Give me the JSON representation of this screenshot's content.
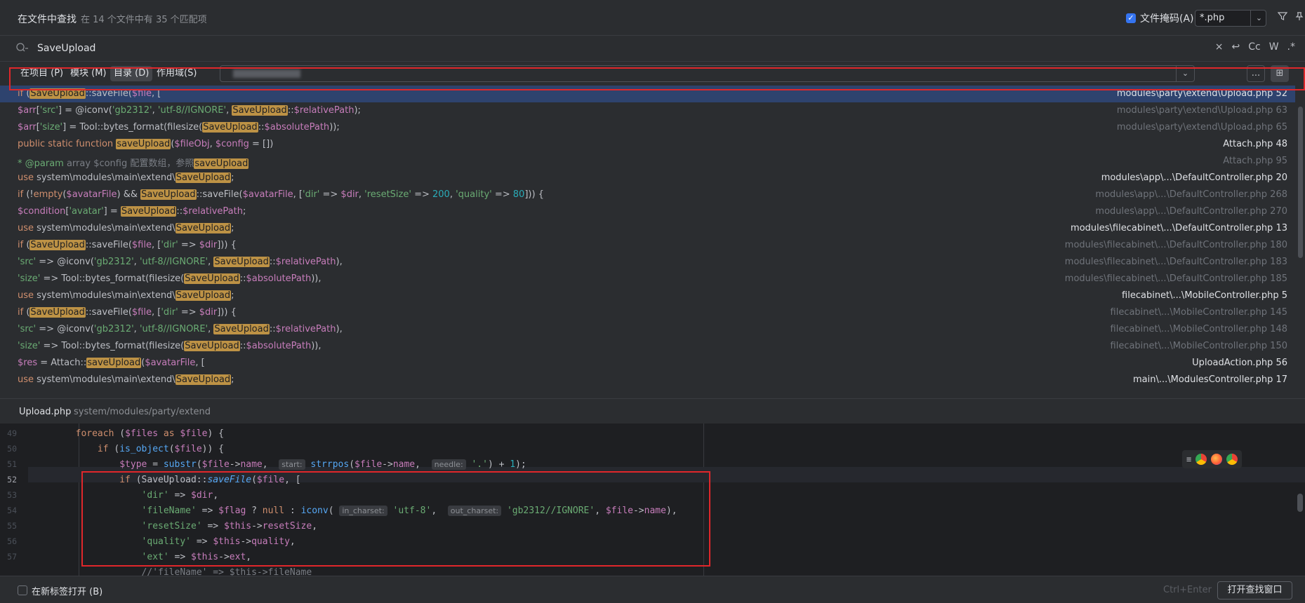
{
  "header": {
    "title": "在文件中查找",
    "subtitle": "在 14 个文件中有 35 个匹配项",
    "file_mask_label": "文件掩码(A):",
    "file_mask_checked": true,
    "file_mask_value": "*.php",
    "filter_icon": "filter-icon",
    "pin_icon": "pin-icon"
  },
  "search": {
    "query": "SaveUpload",
    "icons": [
      "search-icon",
      "clear-icon",
      "newline-icon",
      "match-case",
      "words",
      "regex"
    ],
    "match_case_label": "Cc",
    "words_label": "W",
    "regex_label": ".*"
  },
  "scope": {
    "tabs": [
      "在项目 (P)",
      "模块 (M)",
      "目录 (D)",
      "作用域(S)"
    ],
    "active_tab": "目录 (D)",
    "more_label": "..."
  },
  "results": [
    {
      "code": "if (SaveUpload::saveFile($file, [",
      "location": "modules\\party\\extend\\Upload.php 52",
      "selected": true
    },
    {
      "code": "$arr['src'] = @iconv('gb2312', 'utf-8//IGNORE', SaveUpload::$relativePath);",
      "location": "modules\\party\\extend\\Upload.php 63"
    },
    {
      "code": "$arr['size'] = Tool::bytes_format(filesize(SaveUpload::$absolutePath));",
      "location": "modules\\party\\extend\\Upload.php 65"
    },
    {
      "code": "public static function saveUpload($fileObj, $config = [])",
      "location": "Attach.php 48"
    },
    {
      "code": "* @param array $config 配置数组，参照saveUpload",
      "location": "Attach.php 95"
    },
    {
      "code": "use system\\modules\\main\\extend\\SaveUpload;",
      "location": "modules\\app\\...\\DefaultController.php 20"
    },
    {
      "code": "if (!empty($avatarFile) && SaveUpload::saveFile($avatarFile, ['dir' => $dir, 'resetSize' => 200, 'quality' => 80])) {",
      "location": "modules\\app\\...\\DefaultController.php 268"
    },
    {
      "code": "$condition['avatar'] = SaveUpload::$relativePath;",
      "location": "modules\\app\\...\\DefaultController.php 270"
    },
    {
      "code": "use system\\modules\\main\\extend\\SaveUpload;",
      "location": "modules\\filecabinet\\...\\DefaultController.php 13"
    },
    {
      "code": "if (SaveUpload::saveFile($file, ['dir' => $dir])) {",
      "location": "modules\\filecabinet\\...\\DefaultController.php 180"
    },
    {
      "code": "'src' => @iconv('gb2312', 'utf-8//IGNORE', SaveUpload::$relativePath),",
      "location": "modules\\filecabinet\\...\\DefaultController.php 183"
    },
    {
      "code": "'size' => Tool::bytes_format(filesize(SaveUpload::$absolutePath)),",
      "location": "modules\\filecabinet\\...\\DefaultController.php 185"
    },
    {
      "code": "use system\\modules\\main\\extend\\SaveUpload;",
      "location": "filecabinet\\...\\MobileController.php 5"
    },
    {
      "code": "if (SaveUpload::saveFile($file, ['dir' => $dir])) {",
      "location": "filecabinet\\...\\MobileController.php 145"
    },
    {
      "code": "'src' => @iconv('gb2312', 'utf-8//IGNORE', SaveUpload::$relativePath),",
      "location": "filecabinet\\...\\MobileController.php 148"
    },
    {
      "code": "'size' => Tool::bytes_format(filesize(SaveUpload::$absolutePath)),",
      "location": "filecabinet\\...\\MobileController.php 150"
    },
    {
      "code": "$res = Attach::saveUpload($avatarFile, [",
      "location": "UploadAction.php 56"
    },
    {
      "code": "use system\\modules\\main\\extend\\SaveUpload;",
      "location": "main\\...\\ModulesController.php 17"
    }
  ],
  "preview": {
    "file_name": "Upload.php",
    "file_path": "system/modules/party/extend",
    "current_line": "52",
    "lines": [
      {
        "num": "49",
        "text": "        foreach ($files as $file) {"
      },
      {
        "num": "50",
        "text": "            if (is_object($file)) {"
      },
      {
        "num": "51",
        "text": "                $type = substr($file->name,  start: strrpos($file->name,  needle: '.') + 1);"
      },
      {
        "num": "52",
        "text": "                if (SaveUpload::saveFile($file, ["
      },
      {
        "num": "53",
        "text": "                    'dir' => $dir,"
      },
      {
        "num": "54",
        "text": "                    'fileName' => $flag ? null : iconv( in_charset: 'utf-8',  out_charset: 'gb2312//IGNORE', $file->name),"
      },
      {
        "num": "55",
        "text": "                    'resetSize' => $this->resetSize,"
      },
      {
        "num": "56",
        "text": "                    'quality' => $this->quality,"
      },
      {
        "num": "57",
        "text": "                    'ext' => $this->ext,"
      },
      {
        "num": "",
        "text": "                    //'fileName' => $this->fileName"
      }
    ],
    "browser_icons": [
      "chrome-icon",
      "firefox-icon",
      "chrome-dev-icon"
    ]
  },
  "footer": {
    "open_in_new_tab_label": "在新标签打开 (B)",
    "open_in_new_tab_checked": false,
    "shortcut": "Ctrl+Enter",
    "open_button_label": "打开查找窗口"
  },
  "colors": {
    "background": "#2b2d30",
    "editor_background": "#1e1f22",
    "selection": "#2e436e",
    "match_highlight": "#bd9245",
    "annotation_red": "#e0272b",
    "accent": "#3574f0"
  }
}
